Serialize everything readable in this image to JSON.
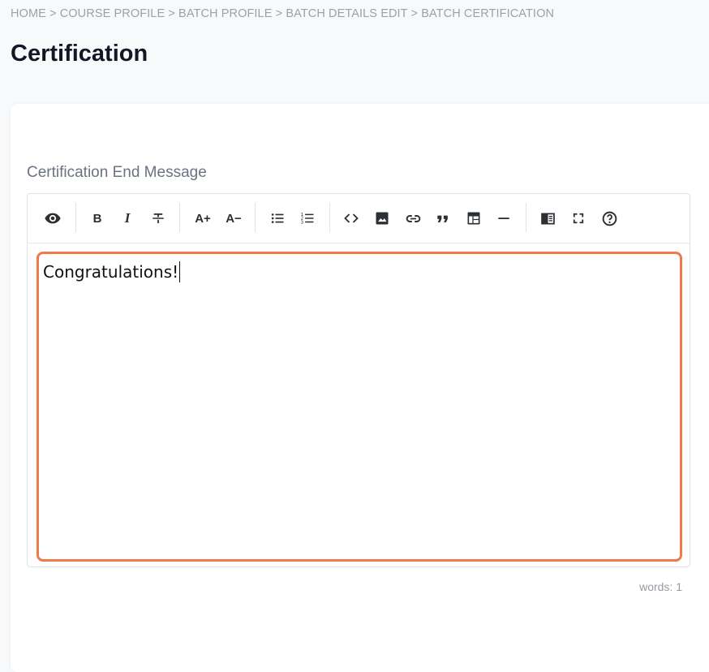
{
  "breadcrumb": {
    "text": "HOME > COURSE PROFILE > BATCH PROFILE > BATCH DETAILS EDIT > BATCH CERTIFICATION"
  },
  "page": {
    "title": "Certification"
  },
  "form": {
    "field_label": "Certification End Message"
  },
  "editor": {
    "toolbar": {
      "bold_label": "B",
      "italic_label": "I",
      "font_up_label": "A+",
      "font_down_label": "A−"
    },
    "content": "Congratulations!",
    "status": "words: 1",
    "accent_color": "#f07a4a"
  },
  "icons": [
    "eye-icon",
    "bold-icon",
    "italic-icon",
    "strikethrough-icon",
    "font-size-up-icon",
    "font-size-down-icon",
    "bullet-list-icon",
    "numbered-list-icon",
    "code-icon",
    "image-icon",
    "link-icon",
    "quote-icon",
    "table-icon",
    "horizontal-rule-icon",
    "side-by-side-icon",
    "fullscreen-icon",
    "help-icon"
  ]
}
